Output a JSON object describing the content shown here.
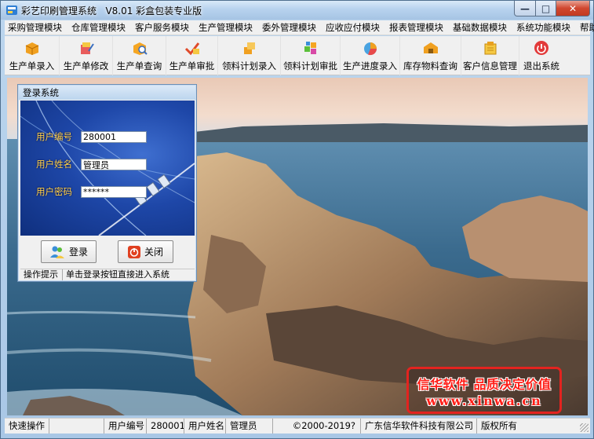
{
  "window": {
    "title": "彩艺印刷管理系统   V8.01 彩盒包装专业版",
    "minimize": "—",
    "maximize": "□",
    "close": "✕"
  },
  "menu": [
    "采购管理模块",
    "仓库管理模块",
    "客户服务模块",
    "生产管理模块",
    "委外管理模块",
    "应收应付模块",
    "报表管理模块",
    "基础数据模块",
    "系统功能模块",
    "帮助"
  ],
  "toolbar": [
    {
      "label": "生产单录入",
      "icon": "box-icon"
    },
    {
      "label": "生产单修改",
      "icon": "edit-box-icon"
    },
    {
      "label": "生产单查询",
      "icon": "search-box-icon"
    },
    {
      "label": "生产单审批",
      "icon": "approve-icon"
    },
    {
      "label": "领料计划录入",
      "icon": "material-plan-icon"
    },
    {
      "label": "领料计划审批",
      "icon": "material-approve-icon"
    },
    {
      "label": "生产进度录入",
      "icon": "progress-icon"
    },
    {
      "label": "库存物料查询",
      "icon": "inventory-icon"
    },
    {
      "label": "客户信息管理",
      "icon": "customer-icon"
    },
    {
      "label": "退出系统",
      "icon": "exit-icon"
    }
  ],
  "login": {
    "title": "登录系统",
    "user_id_label": "用户编号",
    "user_id": "280001",
    "user_name_label": "用户姓名",
    "user_name": "管理员",
    "password_label": "用户密码",
    "password": "******",
    "login_button": "登录",
    "close_button": "关闭",
    "hint_label": "操作提示",
    "hint_text": "单击登录按钮直接进入系统"
  },
  "promo": {
    "line1": "信华软件 品质决定价值",
    "line2": "www.xinwa.cn"
  },
  "status": {
    "quick_op": "快速操作",
    "user_id_label": "用户编号",
    "user_id": "280001",
    "user_name_label": "用户姓名",
    "user_name": "管理员",
    "copyright": "©2000-2019?",
    "company": "广东信华软件科技有限公司",
    "rights": "版权所有"
  }
}
